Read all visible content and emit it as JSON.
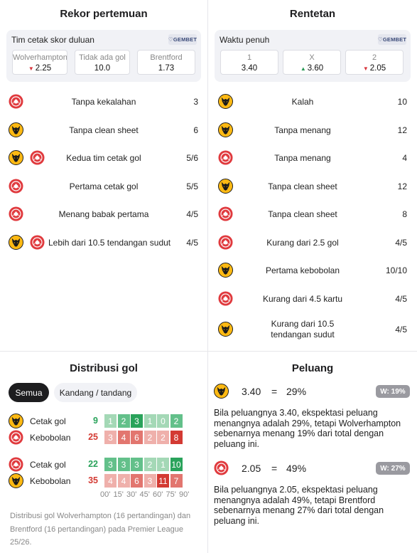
{
  "h2h": {
    "title": "Rekor pertemuan",
    "odds_label": "Tim cetak skor duluan",
    "brand": "GEMBET",
    "cells": [
      {
        "head": "Wolverhampton",
        "value": "2.25",
        "trend": "down"
      },
      {
        "head": "Tidak ada gol",
        "value": "10.0",
        "trend": ""
      },
      {
        "head": "Brentford",
        "value": "1.73",
        "trend": ""
      }
    ],
    "rows": [
      {
        "teams": [
          "brentford"
        ],
        "label": "Tanpa kekalahan",
        "value": "3"
      },
      {
        "teams": [
          "wolves"
        ],
        "label": "Tanpa clean sheet",
        "value": "6"
      },
      {
        "teams": [
          "wolves",
          "brentford"
        ],
        "label": "Kedua tim cetak gol",
        "value": "5/6"
      },
      {
        "teams": [
          "brentford"
        ],
        "label": "Pertama cetak gol",
        "value": "5/5"
      },
      {
        "teams": [
          "brentford"
        ],
        "label": "Menang babak pertama",
        "value": "4/5"
      },
      {
        "teams": [
          "wolves",
          "brentford"
        ],
        "label": "Lebih dari 10.5 tendangan sudut",
        "value": "4/5"
      }
    ]
  },
  "streak": {
    "title": "Rentetan",
    "odds_label": "Waktu penuh",
    "brand": "GEMBET",
    "cells": [
      {
        "head": "1",
        "value": "3.40",
        "trend": ""
      },
      {
        "head": "X",
        "value": "3.60",
        "trend": "up"
      },
      {
        "head": "2",
        "value": "2.05",
        "trend": "down"
      }
    ],
    "rows": [
      {
        "team": "wolves",
        "label": "Kalah",
        "value": "10"
      },
      {
        "team": "wolves",
        "label": "Tanpa menang",
        "value": "12"
      },
      {
        "team": "brentford",
        "label": "Tanpa menang",
        "value": "4"
      },
      {
        "team": "wolves",
        "label": "Tanpa clean sheet",
        "value": "12"
      },
      {
        "team": "brentford",
        "label": "Tanpa clean sheet",
        "value": "8"
      },
      {
        "team": "brentford",
        "label": "Kurang dari 2.5 gol",
        "value": "4/5"
      },
      {
        "team": "wolves",
        "label": "Pertama kebobolan",
        "value": "10/10"
      },
      {
        "team": "brentford",
        "label": "Kurang dari 4.5 kartu",
        "value": "4/5"
      },
      {
        "team": "wolves",
        "label": "Kurang dari 10.5 tendangan sudut",
        "value": "4/5"
      }
    ]
  },
  "distribution": {
    "title": "Distribusi gol",
    "tabs": [
      "Semua",
      "Kandang / tandang"
    ],
    "active_tab": 0,
    "blocks": [
      {
        "rows": [
          {
            "team": "wolves",
            "label": "Cetak gol",
            "total": "9",
            "kind": "scored",
            "values": [
              1,
              2,
              3,
              1,
              0,
              2
            ]
          },
          {
            "team": "brentford",
            "label": "Kebobolan",
            "total": "25",
            "kind": "conceded",
            "values": [
              3,
              4,
              6,
              2,
              2,
              8
            ]
          }
        ]
      },
      {
        "rows": [
          {
            "team": "brentford",
            "label": "Cetak gol",
            "total": "22",
            "kind": "scored",
            "values": [
              3,
              3,
              3,
              2,
              1,
              10
            ]
          },
          {
            "team": "wolves",
            "label": "Kebobolan",
            "total": "35",
            "kind": "conceded",
            "values": [
              4,
              4,
              6,
              3,
              11,
              7
            ]
          }
        ]
      }
    ],
    "ticks": [
      "00'",
      "15'",
      "30'",
      "45'",
      "60'",
      "75'",
      "90'"
    ],
    "footnote": "Distribusi gol Wolverhampton (16 pertandingan) dan Brentford (16 pertandingan) pada Premier League 25/26."
  },
  "chance": {
    "title": "Peluang",
    "items": [
      {
        "team": "wolves",
        "odds": "3.40",
        "eq": "=",
        "pct": "29%",
        "badge": "W: 19%",
        "text": "Bila peluangnya 3.40, ekspektasi peluang menangnya adalah 29%, tetapi Wolverhampton sebenarnya menang 19% dari total dengan peluang ini."
      },
      {
        "team": "brentford",
        "odds": "2.05",
        "eq": "=",
        "pct": "49%",
        "badge": "W: 27%",
        "text": "Bila peluangnya 2.05, ekspektasi peluang menangnya adalah 49%, tetapi Brentford sebenarnya menang 27% dari total dengan peluang ini."
      }
    ]
  },
  "colors": {
    "scored_light": "#a4d8b6",
    "scored_mid": "#63c08a",
    "scored_strong": "#2aa35b",
    "conceded_light": "#efb0ab",
    "conceded_mid": "#e2766f",
    "conceded_strong": "#d33a33",
    "scored_total": "#2aa35b",
    "conceded_total": "#d33a33"
  }
}
